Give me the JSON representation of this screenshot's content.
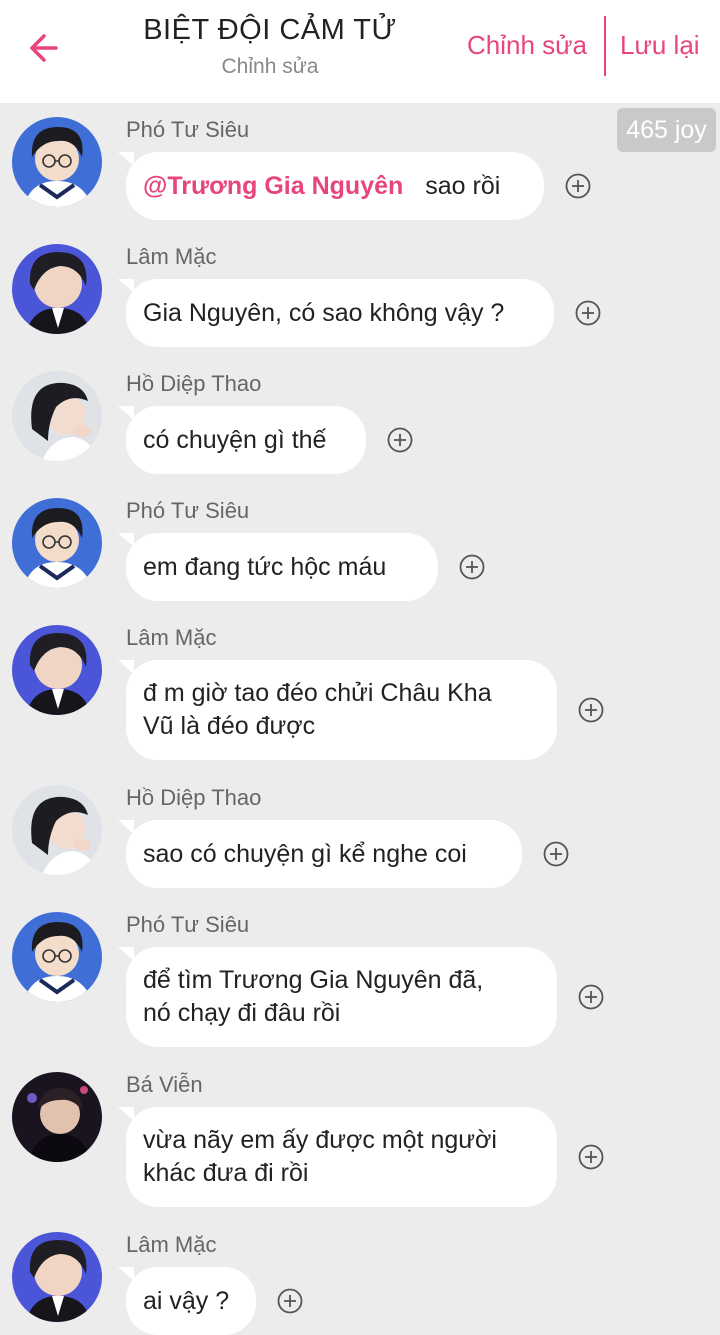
{
  "header": {
    "title": "BIỆT ĐỘI CẢM TỬ",
    "subtitle": "Chỉnh sửa",
    "edit_label": "Chỉnh sửa",
    "save_label": "Lưu lại"
  },
  "joy_badge": "465 joy",
  "messages": [
    {
      "sender": "Phó Tư Siêu",
      "mention": "@Trương Gia Nguyên",
      "lines": [
        "sao rồi"
      ]
    },
    {
      "sender": "Lâm Mặc",
      "lines": [
        "Gia Nguyên, có sao không vậy ?"
      ]
    },
    {
      "sender": "Hồ Diệp Thao",
      "lines": [
        "có chuyện gì thế"
      ]
    },
    {
      "sender": "Phó Tư Siêu",
      "lines": [
        "em đang tức hộc máu"
      ]
    },
    {
      "sender": "Lâm Mặc",
      "lines": [
        "đ m giờ tao đéo chửi Châu Kha",
        "Vũ là đéo được"
      ]
    },
    {
      "sender": "Hồ Diệp Thao",
      "lines": [
        "sao có chuyện gì kể nghe coi"
      ]
    },
    {
      "sender": "Phó Tư Siêu",
      "lines": [
        "để tìm Trương Gia Nguyên đã,",
        "nó chạy đi đâu rồi"
      ]
    },
    {
      "sender": "Bá Viễn",
      "lines": [
        "vừa nãy em ấy được một người",
        "khác đưa đi rồi"
      ]
    },
    {
      "sender": "Lâm Mặc",
      "lines": [
        "ai vậy ?"
      ]
    }
  ],
  "colors": {
    "accent": "#e8457c",
    "background": "#ececec",
    "bubble": "#ffffff"
  }
}
